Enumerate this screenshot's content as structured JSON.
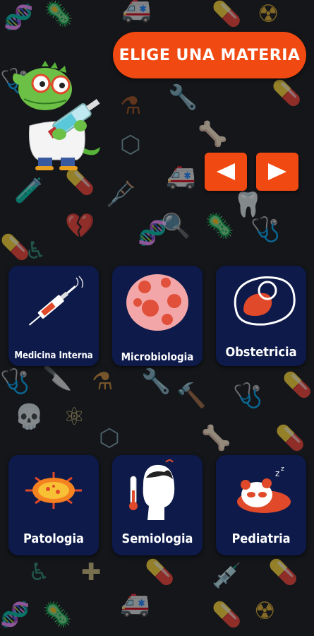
{
  "header": {
    "title": "ELIGE UNA MATERIA"
  },
  "navigation": {
    "prev_icon": "triangle-left",
    "next_icon": "triangle-right"
  },
  "subjects": [
    {
      "label": "Medicina Interna",
      "icon": "syringe-icon"
    },
    {
      "label": "Microbiologia",
      "icon": "bacteria-icon"
    },
    {
      "label": "Obstetricia",
      "icon": "fetus-icon"
    },
    {
      "label": "Patologia",
      "icon": "virus-icon"
    },
    {
      "label": "Semiologia",
      "icon": "patient-thermometer-icon"
    },
    {
      "label": "Pediatria",
      "icon": "sleeping-panda-icon"
    }
  ],
  "colors": {
    "accent": "#f04a12",
    "card_bg": "#0d1a4a",
    "background": "#14161a"
  }
}
